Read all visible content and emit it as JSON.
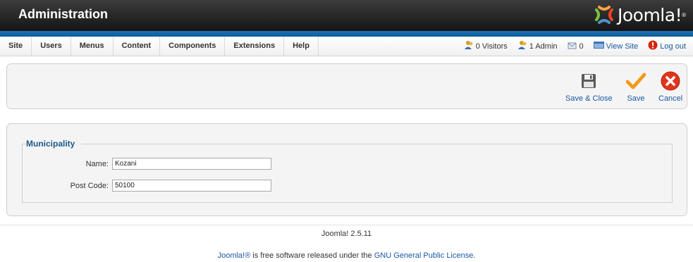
{
  "header": {
    "title": "Administration",
    "logo_text": "Joomla!",
    "logo_tm": "®"
  },
  "menu": [
    {
      "label": "Site"
    },
    {
      "label": "Users"
    },
    {
      "label": "Menus"
    },
    {
      "label": "Content"
    },
    {
      "label": "Components"
    },
    {
      "label": "Extensions"
    },
    {
      "label": "Help"
    }
  ],
  "status": {
    "visitors": "0 Visitors",
    "admins": "1 Admin",
    "messages": "0",
    "view_site": "View Site",
    "logout": "Log out"
  },
  "toolbar": {
    "save_close": "Save & Close",
    "save": "Save",
    "cancel": "Cancel"
  },
  "form": {
    "legend": "Municipality",
    "name_label": "Name:",
    "name_value": "Kozani",
    "postcode_label": "Post Code:",
    "postcode_value": "50100"
  },
  "footer": {
    "version": "Joomla! 2.5.11",
    "license_prefix": "Joomla!®",
    "license_middle": " is free software released under the ",
    "license_link": "GNU General Public License",
    "license_suffix": "."
  },
  "colors": {
    "accent_blue": "#1a58a5",
    "header_dark": "#151515",
    "blue_bar": "#0b5a99",
    "legend_blue": "#1b5b8a"
  }
}
